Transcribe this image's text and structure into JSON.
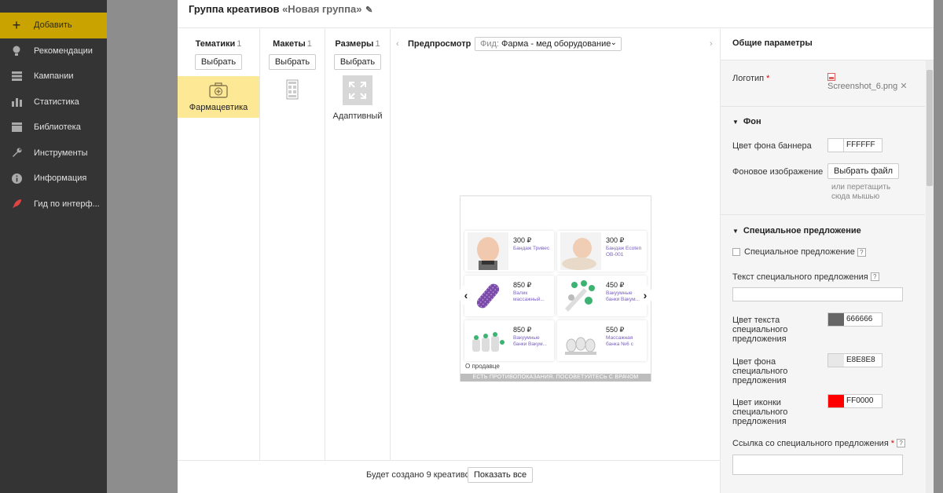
{
  "nav": {
    "items": [
      {
        "label": "Добавить",
        "icon": "plus-icon"
      },
      {
        "label": "Рекомендации",
        "icon": "bulb-icon"
      },
      {
        "label": "Кампании",
        "icon": "list-icon"
      },
      {
        "label": "Статистика",
        "icon": "chart-icon"
      },
      {
        "label": "Библиотека",
        "icon": "library-icon"
      },
      {
        "label": "Инструменты",
        "icon": "wrench-icon"
      },
      {
        "label": "Информация",
        "icon": "info-icon"
      },
      {
        "label": "Гид по интерф...",
        "icon": "rocket-icon"
      }
    ]
  },
  "modal": {
    "title": "Группа креативов",
    "group_name": "«Новая группа»"
  },
  "columns": {
    "themes": {
      "title": "Тематики",
      "count": "1",
      "button": "Выбрать",
      "selected": "Фармацевтика"
    },
    "layouts": {
      "title": "Макеты",
      "count": "1",
      "button": "Выбрать"
    },
    "sizes": {
      "title": "Размеры",
      "count": "1",
      "button": "Выбрать",
      "selected": "Адаптивный"
    }
  },
  "preview": {
    "title": "Предпросмотр",
    "feed_prefix": "Фид:",
    "feed_value": "Фарма - мед оборудование",
    "products": [
      {
        "price": "300 ₽",
        "name": "Бандаж Тривес"
      },
      {
        "price": "300 ₽",
        "name": "Бандаж Ecoten OB-001"
      },
      {
        "price": "850 ₽",
        "name": "Валик массажный..."
      },
      {
        "price": "450 ₽",
        "name": "Вакуумные банки Вакум..."
      },
      {
        "price": "850 ₽",
        "name": "Вакуумные банки Вакум..."
      },
      {
        "price": "550 ₽",
        "name": "Массажная банка №6 с"
      }
    ],
    "seller_link": "О продавце",
    "disclaimer": "ЕСТЬ ПРОТИВОПОКАЗАНИЯ. ПОСОВЕТУЙТЕСЬ С ВРАЧОМ"
  },
  "footer": {
    "text": "Будет создано 9 креативов",
    "button": "Показать все"
  },
  "panel": {
    "title": "Общие параметры",
    "logo_label": "Логотип",
    "logo_file": "Screenshot_6.png",
    "bg_section": "Фон",
    "bg_color_label": "Цвет фона баннера",
    "bg_color": "FFFFFF",
    "bg_image_label": "Фоновое изображение",
    "choose_file": "Выбрать файл",
    "drag_hint": "или перетащить сюда мышью",
    "special_section": "Специальное предложение",
    "special_checkbox": "Специальное предложение",
    "special_text_label": "Текст специального предложения",
    "special_text_value": "",
    "text_color_label": "Цвет текста специального предложения",
    "text_color": "666666",
    "bg_color2_label": "Цвет фона специального предложения",
    "bg_color2": "E8E8E8",
    "icon_color_label": "Цвет иконки специального предложения",
    "icon_color": "FF0000",
    "link_label": "Ссылка со специального предложения",
    "link_value": ""
  },
  "colors": {
    "accent": "#c9a300",
    "selected_card": "#fde896",
    "swatch_text": "#666666",
    "swatch_bg": "#E8E8E8",
    "swatch_icon": "#FF0000"
  }
}
